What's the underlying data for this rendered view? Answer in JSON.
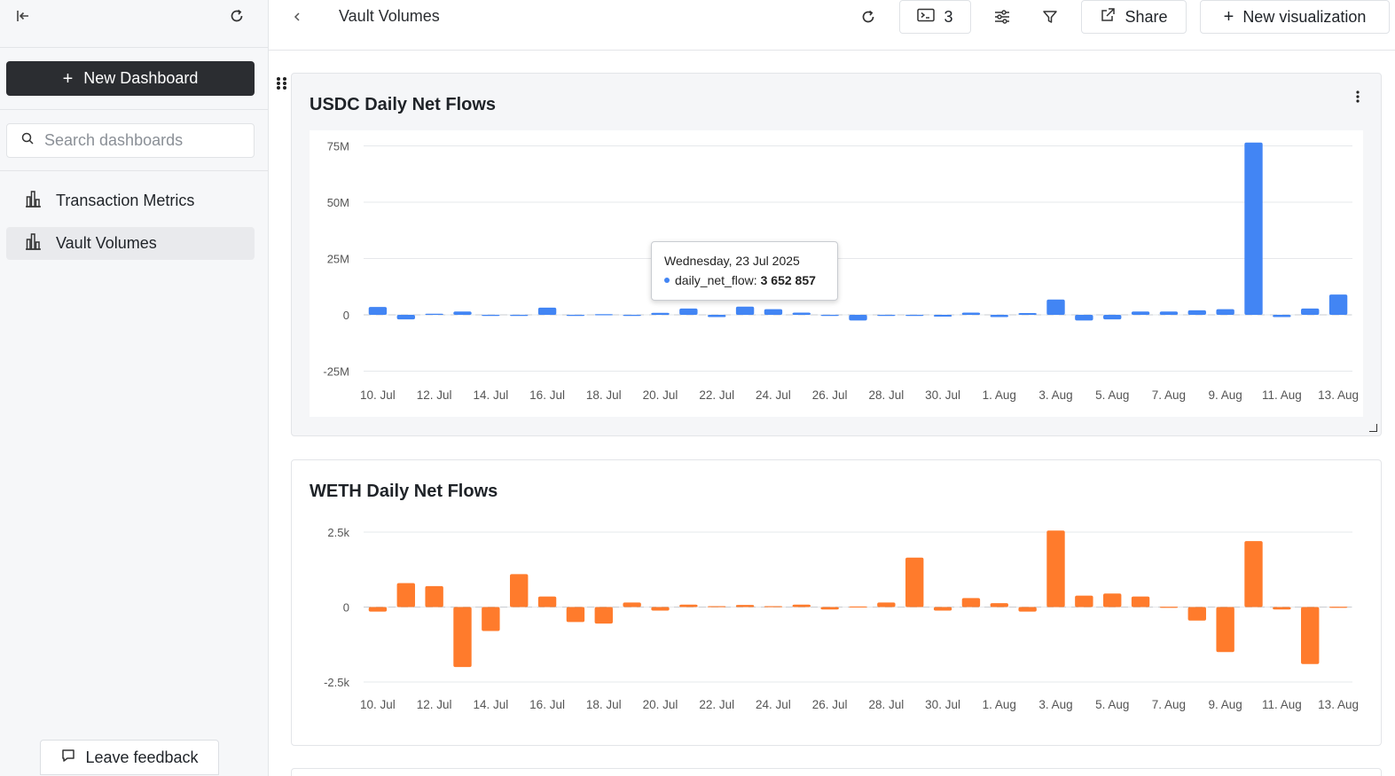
{
  "sidebar": {
    "new_dashboard_label": "New Dashboard",
    "search_placeholder": "Search dashboards",
    "items": [
      {
        "label": "Transaction Metrics",
        "icon": "bar-chart-icon",
        "active": false
      },
      {
        "label": "Vault Volumes",
        "icon": "bar-chart-icon",
        "active": true
      }
    ],
    "feedback_label": "Leave feedback"
  },
  "header": {
    "title": "Vault Volumes",
    "console_count": "3",
    "share_label": "Share",
    "new_visualization_label": "New visualization"
  },
  "colors": {
    "usdc_bar": "#4285f4",
    "weth_bar": "#ff7b2c",
    "primary_button": "#2b2d31",
    "sidebar_bg": "#f6f7f9"
  },
  "panels": {
    "usdc": {
      "title": "USDC Daily Net Flows",
      "tooltip": {
        "date": "Wednesday, 23 Jul 2025",
        "series": "daily_net_flow:",
        "value": "3 652 857"
      }
    },
    "weth": {
      "title": "WETH Daily Net Flows"
    }
  },
  "chart_data": [
    {
      "type": "bar",
      "title": "USDC Daily Net Flows",
      "series": [
        {
          "name": "daily_net_flow",
          "color": "#4285f4",
          "values": [
            3500000,
            -2000000,
            500000,
            1500000,
            0,
            -500000,
            3200000,
            0,
            300000,
            0,
            900000,
            2800000,
            -1000000,
            3652857,
            2500000,
            1000000,
            0,
            -2500000,
            0,
            0,
            -800000,
            1000000,
            -1000000,
            800000,
            6800000,
            -2500000,
            -2000000,
            1500000,
            1500000,
            2000000,
            2500000,
            76500000,
            -1000000,
            2800000,
            9000000
          ]
        }
      ],
      "categories": [
        "10. Jul",
        "11. Jul",
        "12. Jul",
        "13. Jul",
        "14. Jul",
        "15. Jul",
        "16. Jul",
        "17. Jul",
        "18. Jul",
        "19. Jul",
        "20. Jul",
        "21. Jul",
        "22. Jul",
        "23. Jul",
        "24. Jul",
        "25. Jul",
        "26. Jul",
        "27. Jul",
        "28. Jul",
        "29. Jul",
        "30. Jul",
        "31. Jul",
        "1. Aug",
        "2. Aug",
        "3. Aug",
        "4. Aug",
        "5. Aug",
        "6. Aug",
        "7. Aug",
        "8. Aug",
        "9. Aug",
        "10. Aug",
        "11. Aug",
        "12. Aug",
        "13. Aug"
      ],
      "x_tick_labels": [
        "10. Jul",
        "12. Jul",
        "14. Jul",
        "16. Jul",
        "18. Jul",
        "20. Jul",
        "22. Jul",
        "24. Jul",
        "26. Jul",
        "28. Jul",
        "30. Jul",
        "1. Aug",
        "3. Aug",
        "5. Aug",
        "7. Aug",
        "9. Aug",
        "11. Aug",
        "13. Aug"
      ],
      "y_ticks": [
        75000000,
        50000000,
        25000000,
        0,
        -25000000
      ],
      "y_tick_labels": [
        "75M",
        "50M",
        "25M",
        "0",
        "-25M"
      ],
      "ylim": [
        -25000000,
        75000000
      ],
      "grid": true,
      "legend": "none"
    },
    {
      "type": "bar",
      "title": "WETH Daily Net Flows",
      "series": [
        {
          "name": "daily_net_flow",
          "color": "#ff7b2c",
          "values": [
            -150,
            800,
            700,
            -2000,
            -800,
            1100,
            350,
            -500,
            -550,
            150,
            -120,
            80,
            30,
            70,
            30,
            80,
            -80,
            20,
            150,
            1650,
            -120,
            300,
            130,
            -150,
            2550,
            380,
            450,
            350,
            10,
            -450,
            -1500,
            2200,
            -80,
            -1900,
            10
          ]
        }
      ],
      "categories": [
        "10. Jul",
        "11. Jul",
        "12. Jul",
        "13. Jul",
        "14. Jul",
        "15. Jul",
        "16. Jul",
        "17. Jul",
        "18. Jul",
        "19. Jul",
        "20. Jul",
        "21. Jul",
        "22. Jul",
        "23. Jul",
        "24. Jul",
        "25. Jul",
        "26. Jul",
        "27. Jul",
        "28. Jul",
        "29. Jul",
        "30. Jul",
        "31. Jul",
        "1. Aug",
        "2. Aug",
        "3. Aug",
        "4. Aug",
        "5. Aug",
        "6. Aug",
        "7. Aug",
        "8. Aug",
        "9. Aug",
        "10. Aug",
        "11. Aug",
        "12. Aug",
        "13. Aug"
      ],
      "x_tick_labels": [
        "10. Jul",
        "12. Jul",
        "14. Jul",
        "16. Jul",
        "18. Jul",
        "20. Jul",
        "22. Jul",
        "24. Jul",
        "26. Jul",
        "28. Jul",
        "30. Jul",
        "1. Aug",
        "3. Aug",
        "5. Aug",
        "7. Aug",
        "9. Aug",
        "11. Aug",
        "13. Aug"
      ],
      "y_ticks": [
        2500,
        0,
        -2500
      ],
      "y_tick_labels": [
        "2.5k",
        "0",
        "-2.5k"
      ],
      "ylim": [
        -2500,
        2500
      ],
      "grid": true,
      "legend": "none"
    }
  ]
}
